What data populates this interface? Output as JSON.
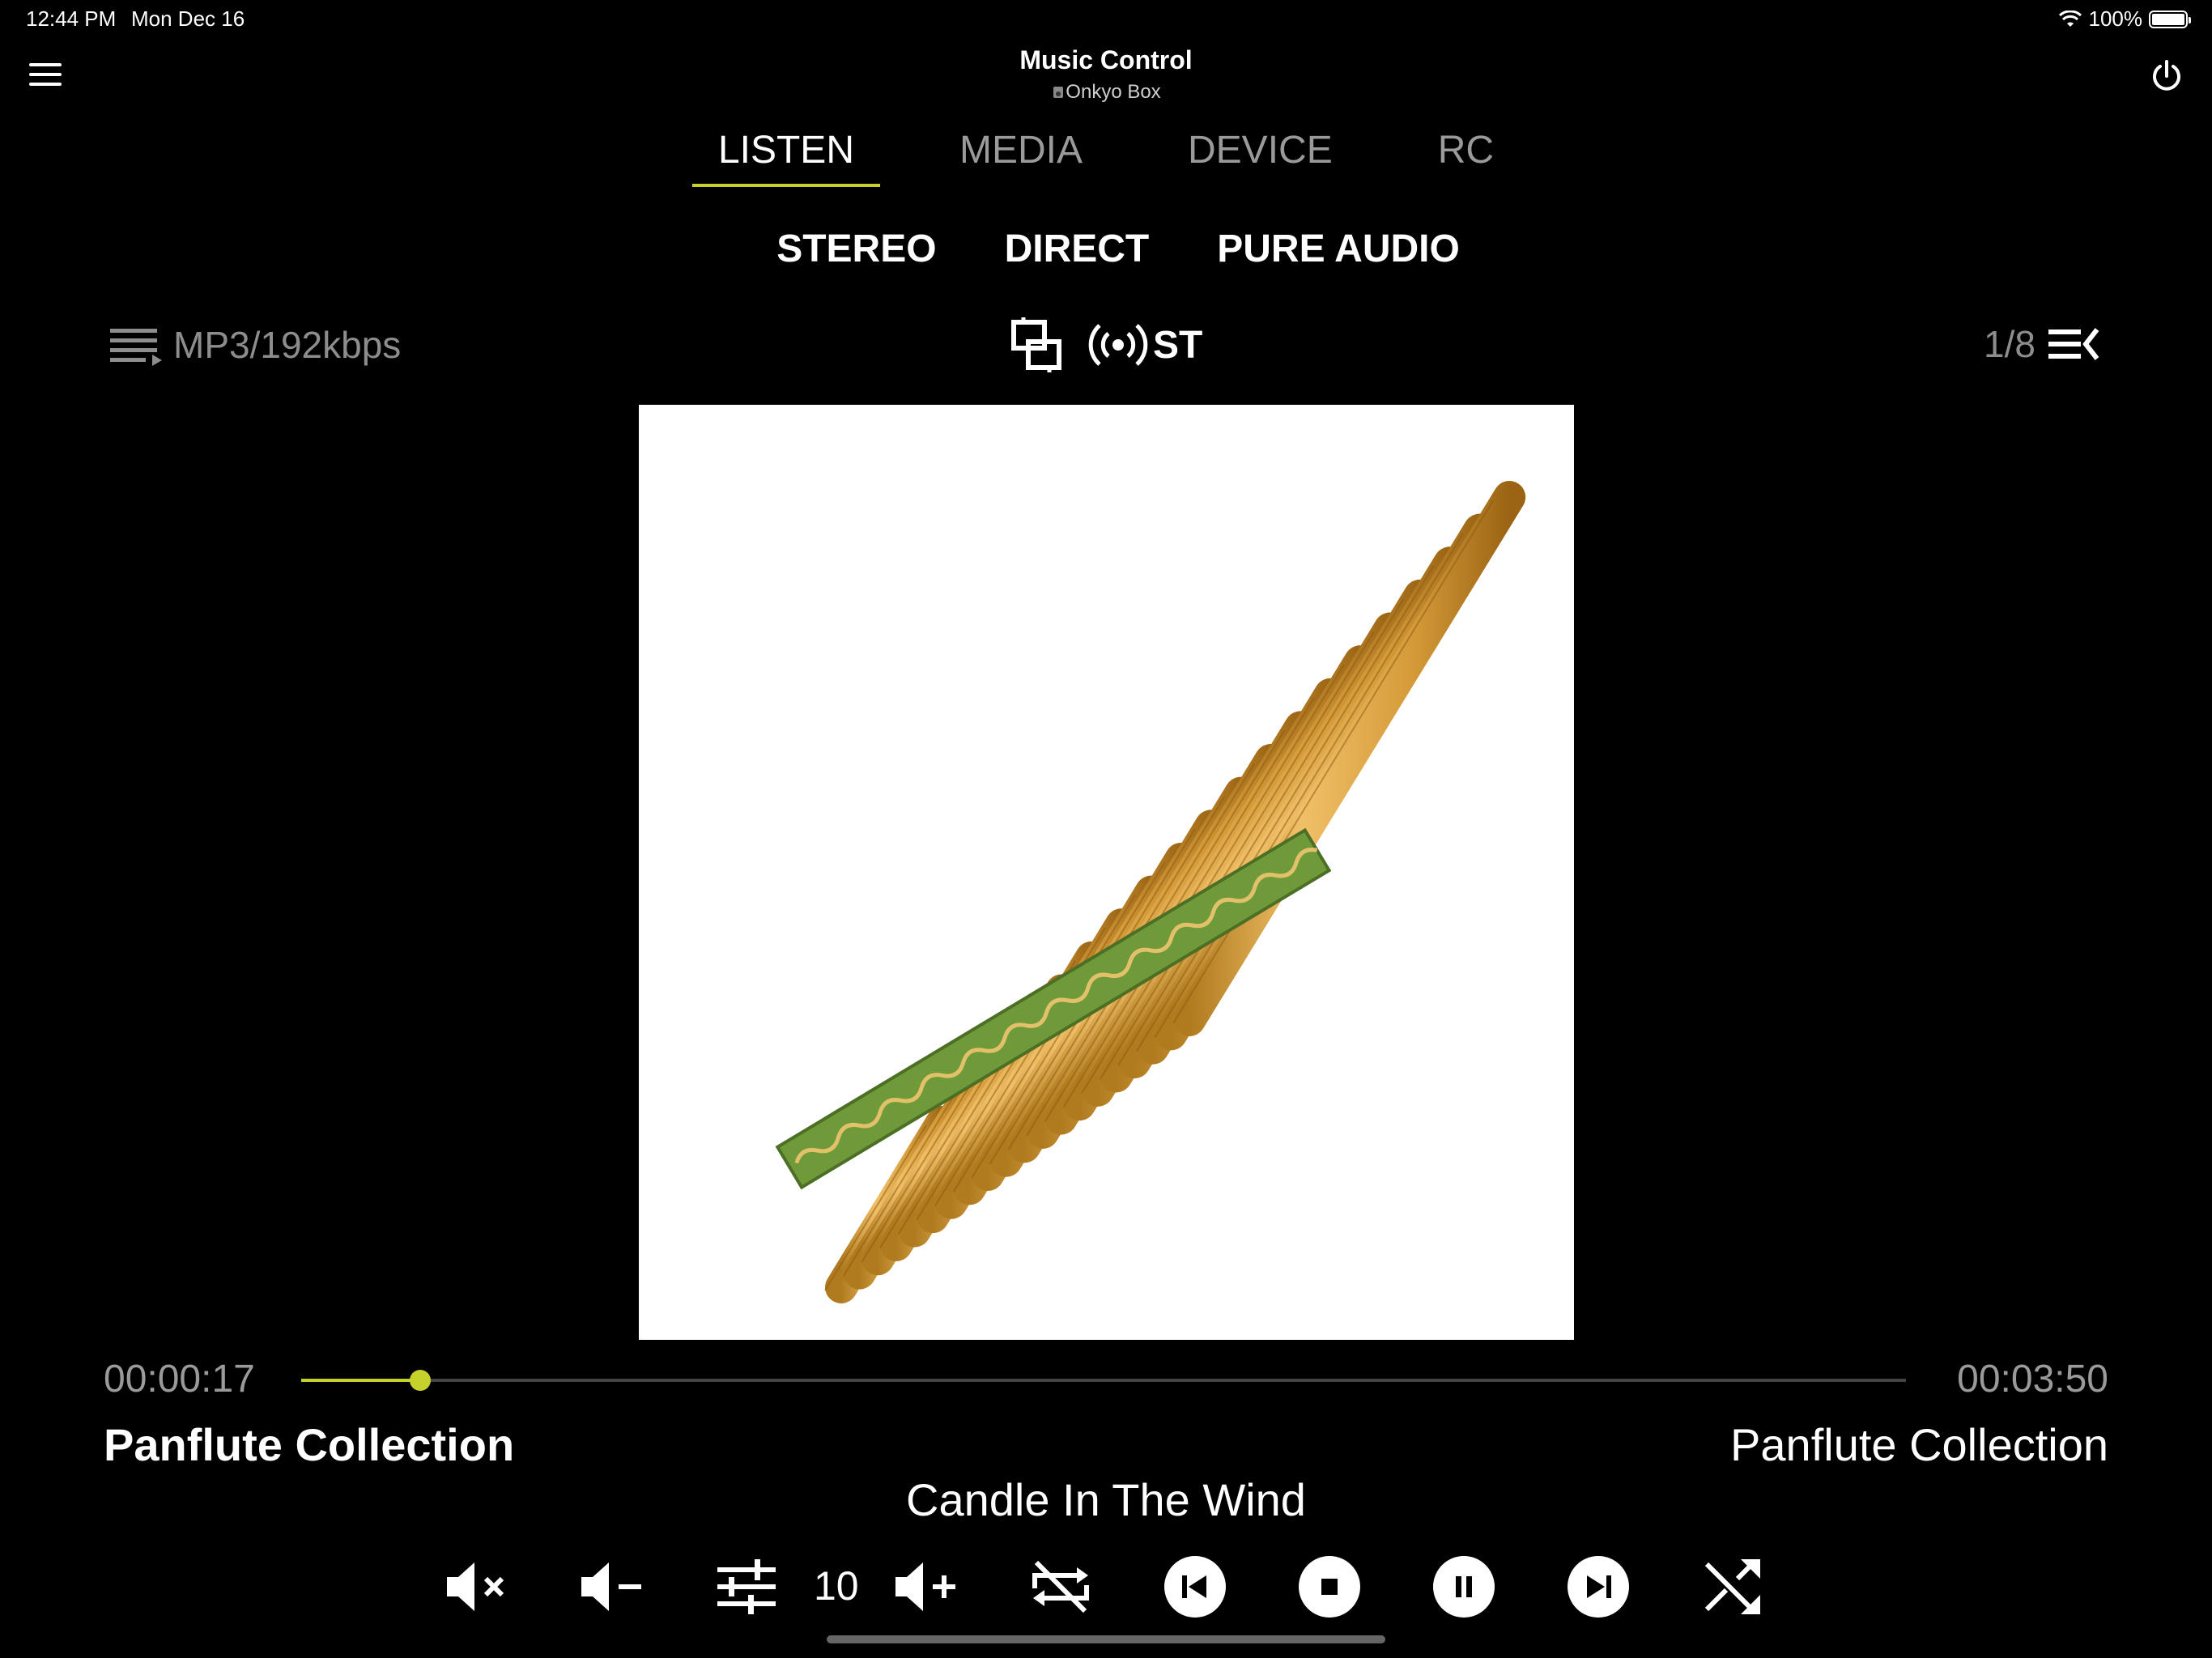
{
  "status_bar": {
    "time": "12:44 PM",
    "date": "Mon Dec 16",
    "battery": "100%"
  },
  "header": {
    "title": "Music Control",
    "device": "Onkyo Box"
  },
  "tabs": [
    {
      "label": "LISTEN",
      "active": true
    },
    {
      "label": "MEDIA",
      "active": false
    },
    {
      "label": "DEVICE",
      "active": false
    },
    {
      "label": "RC",
      "active": false
    }
  ],
  "listening_modes": [
    "STEREO",
    "DIRECT",
    "PURE AUDIO"
  ],
  "info_bar": {
    "format": "MP3/192kbps",
    "signal": "ST",
    "queue_position": "1/8"
  },
  "playback": {
    "elapsed": "00:00:17",
    "total": "00:03:50",
    "progress_fraction": 0.074,
    "album": "Panflute Collection",
    "artist": "Panflute Collection",
    "track": "Candle In The Wind"
  },
  "controls": {
    "volume": "10"
  },
  "icons": {
    "menu": "hamburger-menu-icon",
    "power": "power-icon",
    "playlist": "playlist-icon",
    "input": "input-select-icon",
    "broadcast": "broadcast-icon",
    "queue": "queue-list-icon",
    "mute": "mute-icon",
    "vol_down": "volume-down-icon",
    "eq": "equalizer-icon",
    "vol_up": "volume-up-icon",
    "repeat": "repeat-off-icon",
    "prev": "previous-track-icon",
    "stop": "stop-icon",
    "pause": "pause-icon",
    "next": "next-track-icon",
    "shuffle": "shuffle-icon"
  },
  "accent_color": "#c6d12c"
}
